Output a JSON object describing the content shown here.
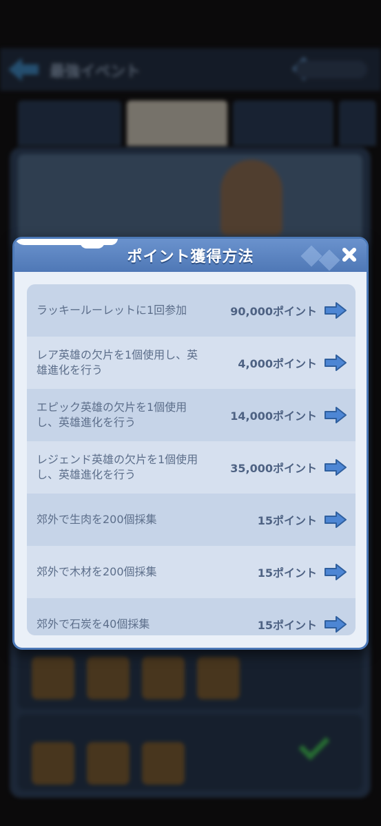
{
  "background": {
    "header_title": "最強イベント"
  },
  "dialog": {
    "title": "ポイント獲得方法",
    "rows": [
      {
        "label": "ラッキールーレットに1回参加",
        "points": "90,000ポイント"
      },
      {
        "label": "レア英雄の欠片を1個使用し、英雄進化を行う",
        "points": "4,000ポイント"
      },
      {
        "label": "エピック英雄の欠片を1個使用し、英雄進化を行う",
        "points": "14,000ポイント"
      },
      {
        "label": "レジェンド英雄の欠片を1個使用し、英雄進化を行う",
        "points": "35,000ポイント"
      },
      {
        "label": "郊外で生肉を200個採集",
        "points": "15ポイント"
      },
      {
        "label": "郊外で木材を200個採集",
        "points": "15ポイント"
      },
      {
        "label": "郊外で石炭を40個採集",
        "points": "15ポイント"
      }
    ]
  },
  "colors": {
    "header_blue": "#4f78b6",
    "arrow_blue": "#4d86d4",
    "row_dark": "#c6d4e8",
    "row_light": "#d6e0ef"
  },
  "icons": {
    "close": "close-icon",
    "go": "arrow-right-icon",
    "back": "back-arrow-icon"
  }
}
